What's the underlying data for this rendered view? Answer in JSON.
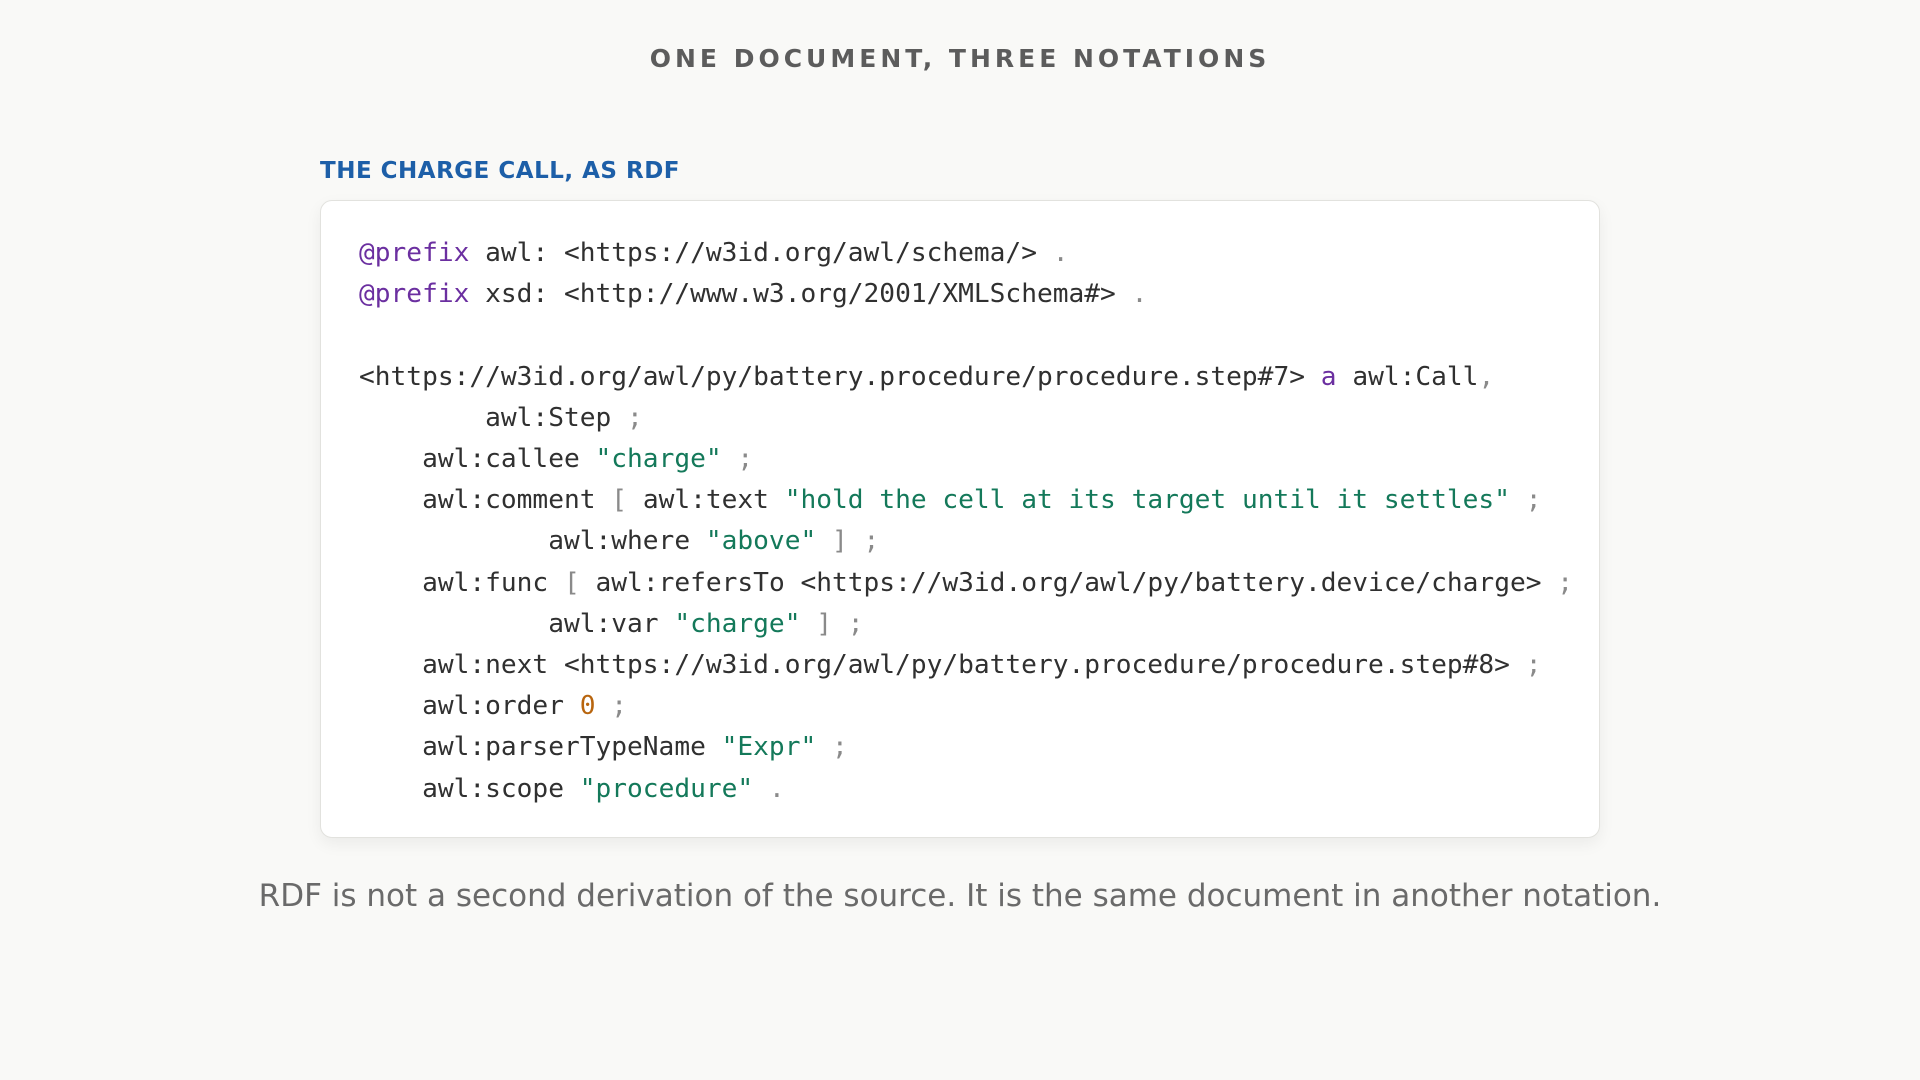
{
  "heading": "ONE DOCUMENT, THREE NOTATIONS",
  "section_label": "THE CHARGE CALL, AS RDF",
  "caption": "RDF is not a second derivation of the source. It is the same document in another notation.",
  "code": {
    "prefix_kw": "@prefix",
    "prefix_awl": " awl: <https://w3id.org/awl/schema/>",
    "prefix_xsd": " xsd: <http://www.w3.org/2001/XMLSchema#>",
    "dot": " .",
    "semi": " ;",
    "subject": "<https://w3id.org/awl/py/battery.procedure/procedure.step#7>",
    "a_kw": "a",
    "call": " awl:Call",
    "comma": ",",
    "step": "        awl:Step",
    "callee_pred": "    awl:callee ",
    "callee_val": "\"charge\"",
    "comment_pred": "    awl:comment",
    "open_bracket": " [",
    "text_pred": " awl:text ",
    "text_val": "\"hold the cell at its target until it settles\"",
    "where_pred": "            awl:where ",
    "where_val": "\"above\"",
    "close_bracket": " ]",
    "func_pred": "    awl:func",
    "refers_pred": " awl:refersTo <https://w3id.org/awl/py/battery.device/charge>",
    "var_pred": "            awl:var ",
    "var_val": "\"charge\"",
    "next_pred": "    awl:next <https://w3id.org/awl/py/battery.procedure/procedure.step#8>",
    "order_pred": "    awl:order ",
    "order_val": "0",
    "parser_pred": "    awl:parserTypeName ",
    "parser_val": "\"Expr\"",
    "scope_pred": "    awl:scope ",
    "scope_val": "\"procedure\""
  }
}
